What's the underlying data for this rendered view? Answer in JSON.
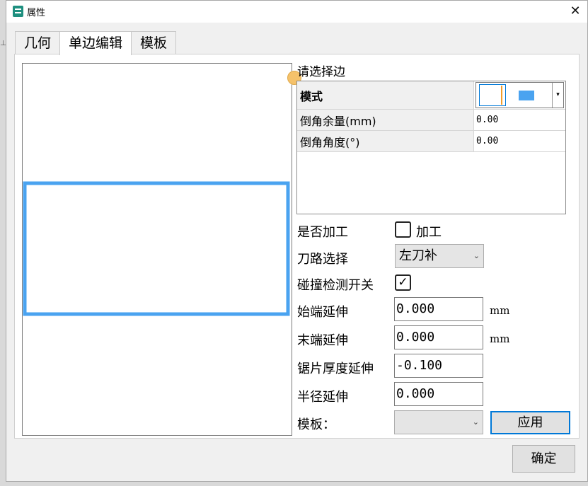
{
  "window": {
    "title": "属性",
    "close_glyph": "✕"
  },
  "tabs": [
    {
      "label": "几何"
    },
    {
      "label": "单边编辑"
    },
    {
      "label": "模板"
    }
  ],
  "active_tab": "单边编辑",
  "edge_panel": {
    "title": "请选择边",
    "rows": [
      {
        "key": "模式",
        "value": ""
      },
      {
        "key": "倒角余量(mm)",
        "value": "0.00"
      },
      {
        "key": "倒角角度(°)",
        "value": "0.00"
      }
    ],
    "mode_arrow": "▾"
  },
  "form": {
    "process_label": "是否加工",
    "process_checkbox_label": "加工",
    "process_checked": false,
    "toolpath_label": "刀路选择",
    "toolpath_value": "左刀补",
    "collision_label": "碰撞检测开关",
    "collision_checked": true,
    "start_ext_label": "始端延伸",
    "start_ext_value": "0.000",
    "start_ext_unit": "mm",
    "end_ext_label": "末端延伸",
    "end_ext_value": "0.000",
    "end_ext_unit": "mm",
    "blade_ext_label": "锯片厚度延伸",
    "blade_ext_value": "-0.100",
    "radius_ext_label": "半径延伸",
    "radius_ext_value": "0.000",
    "template_label": "模板：",
    "template_value": "",
    "apply_label": "应用"
  },
  "ok_label": "确定",
  "combo_arrow": "⌄",
  "check_glyph": "✓",
  "colors": {
    "edge_blue": "#4aa3f0",
    "handle_orange": "#f5c26b",
    "focus_blue": "#0078d7"
  }
}
